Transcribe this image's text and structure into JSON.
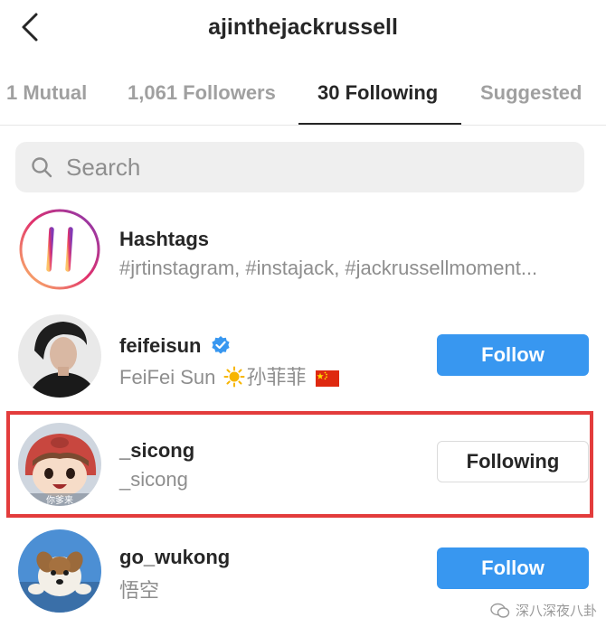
{
  "header": {
    "title": "ajinthejackrussell"
  },
  "tabs": [
    {
      "label": "1 Mutual"
    },
    {
      "label": "1,061 Followers"
    },
    {
      "label": "30 Following"
    },
    {
      "label": "Suggested"
    }
  ],
  "search": {
    "placeholder": "Search"
  },
  "hashtags": {
    "name": "Hashtags",
    "subtitle": "#jrtinstagram, #instajack, #jackrussellmoment..."
  },
  "users": [
    {
      "name": "feifeisun",
      "subtitle": "FeiFei Sun",
      "subtitle_cn": "孙菲菲",
      "button": "Follow",
      "verified": true
    },
    {
      "name": "_sicong",
      "subtitle": "_sicong",
      "button": "Following",
      "avatar_text": "你爹来"
    },
    {
      "name": "go_wukong",
      "subtitle": "悟空",
      "button": "Follow"
    }
  ],
  "watermark": {
    "text": "深八深夜八卦"
  },
  "colors": {
    "accent": "#3897f0",
    "highlight": "#e33c3c",
    "muted": "#8e8e8e"
  }
}
